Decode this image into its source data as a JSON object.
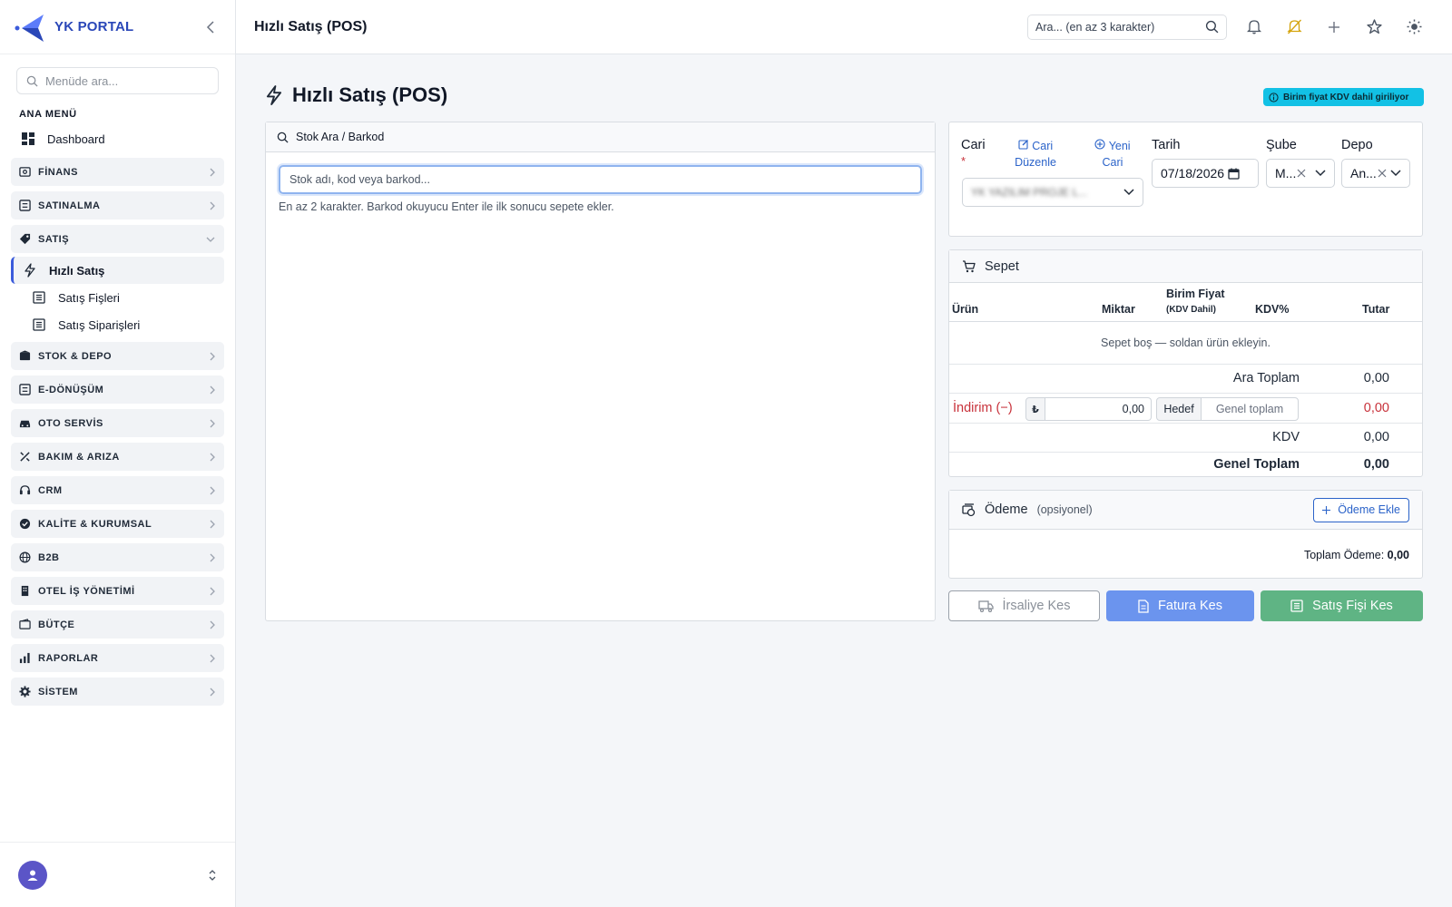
{
  "sidebar": {
    "logo": "YK PORTAL",
    "search_placeholder": "Menüde ara...",
    "section": "ANA MENÜ",
    "dashboard": "Dashboard",
    "groups_top": [
      "FİNANS",
      "SATINALMA"
    ],
    "satis": "SATIŞ",
    "satis_items": [
      "Hızlı Satış",
      "Satış Fişleri",
      "Satış Siparişleri"
    ],
    "groups_bottom": [
      "STOK & DEPO",
      "E-DÖNÜŞÜM",
      "OTO SERVİS",
      "BAKIM & ARIZA",
      "CRM",
      "KALİTE & KURUMSAL",
      "B2B",
      "OTEL İŞ YÖNETİMİ",
      "BÜTÇE",
      "RAPORLAR",
      "SİSTEM"
    ]
  },
  "topbar": {
    "title": "Hızlı Satış (POS)",
    "search_placeholder": "Ara... (en az 3 karakter)"
  },
  "page": {
    "title": "Hızlı Satış (POS)",
    "info_badge": "Birim fiyat KDV dahil giriliyor"
  },
  "stock": {
    "header": "Stok Ara / Barkod",
    "placeholder": "Stok adı, kod veya barkod...",
    "hint": "En az 2 karakter. Barkod okuyucu Enter ile ilk sonucu sepete ekler."
  },
  "form": {
    "cari_label": "Cari",
    "required_mark": "*",
    "cari_edit_1": "Cari",
    "cari_edit_2": "Düzenle",
    "new_cari_1": "Yeni",
    "new_cari_2": "Cari",
    "cari_value": "YK YAZILIM PROJE L...",
    "tarih_label": "Tarih",
    "tarih_value": "07/18/2026",
    "sube_label": "Şube",
    "sube_value": "M...",
    "depo_label": "Depo",
    "depo_value": "An..."
  },
  "cart": {
    "title": "Sepet",
    "col_urun": "Ürün",
    "col_miktar": "Miktar",
    "col_fiyat": "Birim Fiyat",
    "col_fiyat_sub": "(KDV Dahil)",
    "col_kdv": "KDV%",
    "col_tutar": "Tutar",
    "empty": "Sepet boş — soldan ürün ekleyin.",
    "ara_toplam_label": "Ara Toplam",
    "ara_toplam": "0,00",
    "indirim_label": "İndirim (−)",
    "currency": "₺",
    "indirim_input": "0,00",
    "hedef": "Hedef",
    "hedef_value": "Genel toplam",
    "indirim": "0,00",
    "kdv_label": "KDV",
    "kdv": "0,00",
    "genel_label": "Genel Toplam",
    "genel": "0,00"
  },
  "payment": {
    "title": "Ödeme",
    "optional": "(opsiyonel)",
    "add": "Ödeme Ekle",
    "total_label": "Toplam Ödeme:",
    "total": "0,00"
  },
  "actions": {
    "irsaliye": "İrsaliye Kes",
    "fatura": "Fatura Kes",
    "fis": "Satış Fişi Kes"
  },
  "colors": {
    "accent": "#2b63c9",
    "info": "#12c1e5",
    "danger": "#c8323b",
    "success": "#5fb484",
    "primary_btn": "#6b94ee"
  }
}
